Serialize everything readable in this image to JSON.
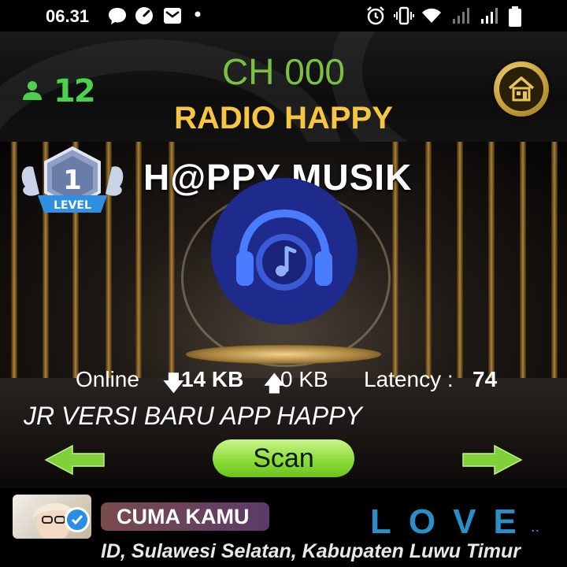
{
  "status_bar": {
    "time": "06.31",
    "notification_icons": [
      "chat-bubble-icon",
      "speed-icon",
      "mail-icon",
      "dot-icon"
    ],
    "system_icons": [
      "alarm-icon",
      "vibrate-icon",
      "wifi-icon",
      "signal-icon",
      "signal-icon",
      "battery-icon"
    ]
  },
  "header": {
    "user_count": "12",
    "channel": "CH 000",
    "radio_name": "RADIO HAPPY",
    "home_icon": "home-icon"
  },
  "stage": {
    "level_badge": {
      "number": "1",
      "label": "LEVEL"
    },
    "station_title": "H@PPY MUSIK",
    "logo_icon": "headphones-music-icon",
    "stats": {
      "online_label": "Online",
      "download": "14 KB",
      "upload": "0 KB",
      "latency_label": "Latency :",
      "latency_value": "74"
    },
    "marquee": "JR VERSI BARU APP HAPPY",
    "scan_label": "Scan",
    "prev_icon": "arrow-left-icon",
    "next_icon": "arrow-right-icon"
  },
  "footer": {
    "song": "CUMA KAMU",
    "love": "LOVE",
    "love_suffix": "..",
    "location": "ID, Sulawesi Selatan, Kabupaten Luwu Timur"
  },
  "colors": {
    "accent_green": "#7ac143",
    "radio_gold": "#f6c542",
    "love_blue": "#2a8fc8",
    "logo_blue": "#1e2a8c"
  }
}
